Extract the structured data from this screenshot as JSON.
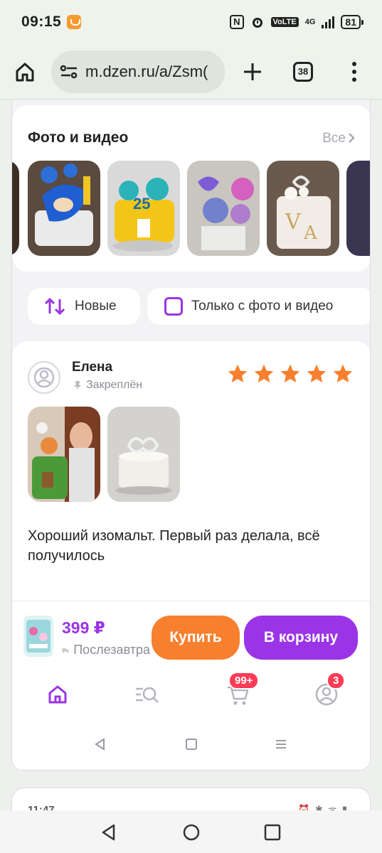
{
  "status_bar": {
    "time": "09:15",
    "network": "4G",
    "volte": "VoLTE",
    "battery": "81",
    "nfc": "N"
  },
  "browser": {
    "url": "m.dzen.ru/a/Zsm(",
    "tab_count": "38"
  },
  "media_section": {
    "title": "Фото и видео",
    "all_label": "Все"
  },
  "filters": {
    "sort_label": "Новые",
    "photo_only_label": "Только с фото и видео"
  },
  "review": {
    "author": "Елена",
    "pinned_label": "Закреплён",
    "rating": 5,
    "rating_max": 5,
    "text": "Хороший изомальт. Первый раз делала, всё получилось"
  },
  "buy_bar": {
    "price": "399 ₽",
    "delivery": "Послезавтра",
    "buy_label": "Купить",
    "cart_label": "В корзину"
  },
  "app_nav": {
    "cart_badge": "99+",
    "profile_badge": "3"
  },
  "second_card": {
    "time": "11:47",
    "status": "⏰ ✱ ᯤ ▮"
  },
  "colors": {
    "accent": "#9b34e6",
    "buy_button": "#f7802f",
    "star": "#f7802f",
    "badge": "#ff3b56"
  }
}
